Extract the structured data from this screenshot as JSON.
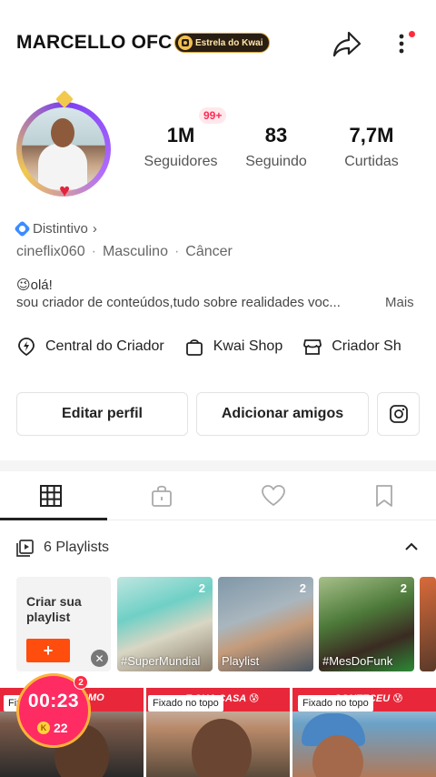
{
  "header": {
    "username": "MARCELLO OFC",
    "badge_label": "Estrela do Kwai"
  },
  "stats": {
    "notification_badge": "99+",
    "items": [
      {
        "value": "1M",
        "label": "Seguidores"
      },
      {
        "value": "83",
        "label": "Seguindo"
      },
      {
        "value": "7,7M",
        "label": "Curtidas"
      }
    ]
  },
  "profile": {
    "distintivo": "Distintivo",
    "meta": [
      "cineflix060",
      "Masculino",
      "Câncer"
    ],
    "bio_line1": "😉olá!",
    "bio_line2": "sou criador de conteúdos,tudo sobre realidades voc...",
    "bio_more": "Mais"
  },
  "shortcuts": [
    {
      "label": "Central do Criador",
      "icon": "lightning-pin-icon"
    },
    {
      "label": "Kwai Shop",
      "icon": "shopping-bag-icon"
    },
    {
      "label": "Criador Sh",
      "icon": "shop-icon"
    }
  ],
  "actions": {
    "edit_profile": "Editar perfil",
    "add_friends": "Adicionar amigos",
    "instagram_icon": "instagram-icon"
  },
  "tabs": [
    {
      "name": "grid",
      "icon": "grid-icon",
      "active": true
    },
    {
      "name": "private",
      "icon": "lock-icon",
      "active": false
    },
    {
      "name": "likes",
      "icon": "heart-icon",
      "active": false
    },
    {
      "name": "saved",
      "icon": "bookmark-icon",
      "active": false
    }
  ],
  "playlists": {
    "header": "6 Playlists",
    "create_label": "Criar sua playlist",
    "create_button": "+",
    "items": [
      {
        "name": "#SuperMundial",
        "count": "2"
      },
      {
        "name": "Playlist",
        "count": "2"
      },
      {
        "name": "#MesDoFunk",
        "count": "2"
      }
    ]
  },
  "videos": [
    {
      "pinned_label": "Fixado no topo",
      "caption": "VAI ...MESMO"
    },
    {
      "pinned_label": "Fixado no topo",
      "caption": "...E SUA CASA 😰"
    },
    {
      "pinned_label": "Fixado no topo",
      "caption": "...CONTECEU 😰"
    }
  ],
  "timer": {
    "time": "00:23",
    "coins": "22",
    "badge": "2"
  },
  "colors": {
    "accent": "#ff4d0d",
    "timer_bg": "#ff2b63",
    "video_strip": "#e8283a"
  }
}
